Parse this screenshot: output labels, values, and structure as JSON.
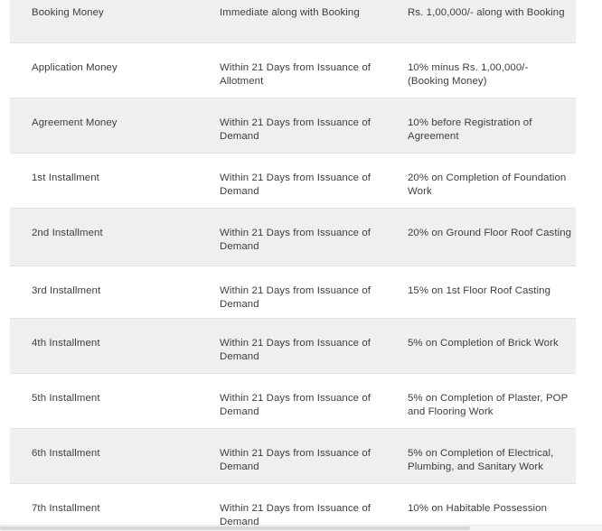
{
  "payment_plan": {
    "rows": [
      {
        "stage": "Booking Money",
        "timeline": "Immediate along with Booking",
        "amount": "Rs. 1,00,000/- along with Booking"
      },
      {
        "stage": "Application Money",
        "timeline": "Within 21 Days from Issuance of Allotment",
        "amount": "10% minus Rs. 1,00,000/- (Booking Money)"
      },
      {
        "stage": "Agreement Money",
        "timeline": "Within 21 Days from Issuance of Demand",
        "amount": "10% before Registration of Agreement"
      },
      {
        "stage": "1st Installment",
        "timeline": "Within 21 Days from Issuance of Demand",
        "amount": "20% on Completion of Foundation Work"
      },
      {
        "stage": "2nd Installment",
        "timeline": "Within 21 Days from Issuance of Demand",
        "amount": "20% on Ground Floor Roof Casting"
      },
      {
        "stage": "3rd Installment",
        "timeline": "Within 21 Days from Issuance of Demand",
        "amount": "15% on 1st Floor Roof Casting"
      },
      {
        "stage": "4th Installment",
        "timeline": "Within 21 Days from Issuance of Demand",
        "amount": "5% on Completion of Brick Work"
      },
      {
        "stage": "5th Installment",
        "timeline": "Within 21 Days from Issuance of Demand",
        "amount": "5% on Completion of Plaster, POP and Flooring Work"
      },
      {
        "stage": "6th Installment",
        "timeline": "Within 21 Days from Issuance of Demand",
        "amount": "5% on Completion of Electrical, Plumbing, and Sanitary Work"
      },
      {
        "stage": "7th Installment",
        "timeline": "Within 21 Days from Issuance of Demand",
        "amount": "10% on Habitable Possession"
      }
    ]
  },
  "colors": {
    "row_shade": "#efefef",
    "text": "#3d3d3d",
    "divider": "#e2e2e2"
  }
}
